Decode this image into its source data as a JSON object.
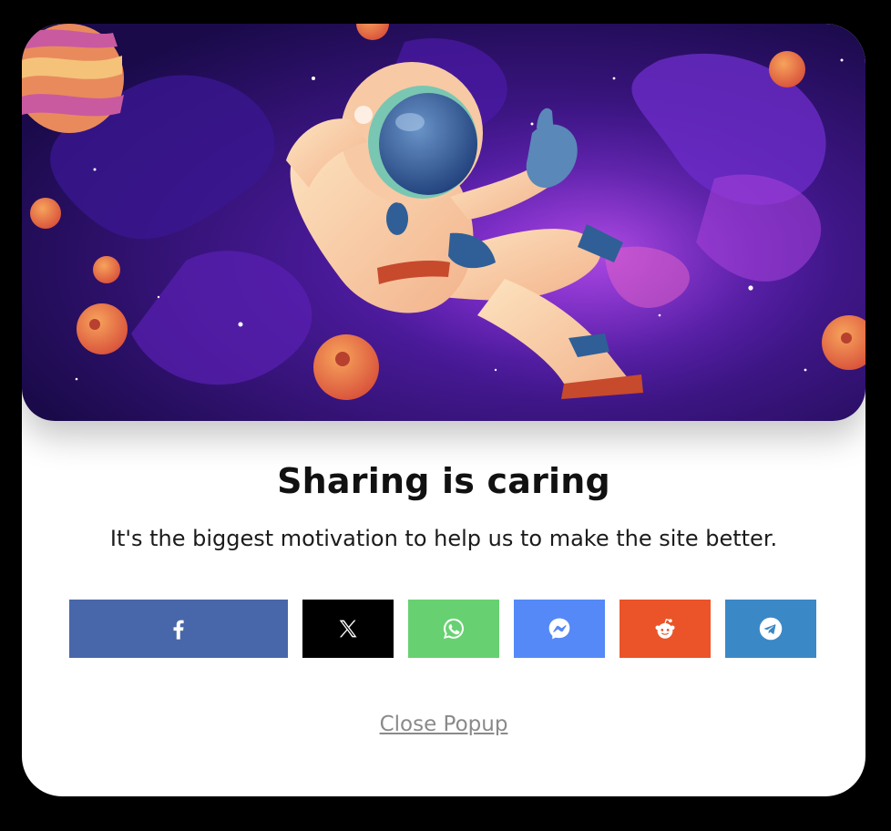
{
  "popup": {
    "title": "Sharing is caring",
    "subtitle": "It's the biggest motivation to help us to make the site better.",
    "close_label": "Close Popup"
  },
  "hero": {
    "illustration": "astronaut floating in space"
  },
  "share_buttons": [
    {
      "name": "facebook",
      "icon": "facebook-icon",
      "color": "#4867AA"
    },
    {
      "name": "x",
      "icon": "x-icon",
      "color": "#000000"
    },
    {
      "name": "whatsapp",
      "icon": "whatsapp-icon",
      "color": "#67D171"
    },
    {
      "name": "messenger",
      "icon": "messenger-icon",
      "color": "#5589F7"
    },
    {
      "name": "reddit",
      "icon": "reddit-icon",
      "color": "#EA5428"
    },
    {
      "name": "telegram",
      "icon": "telegram-icon",
      "color": "#3B88C6"
    }
  ]
}
